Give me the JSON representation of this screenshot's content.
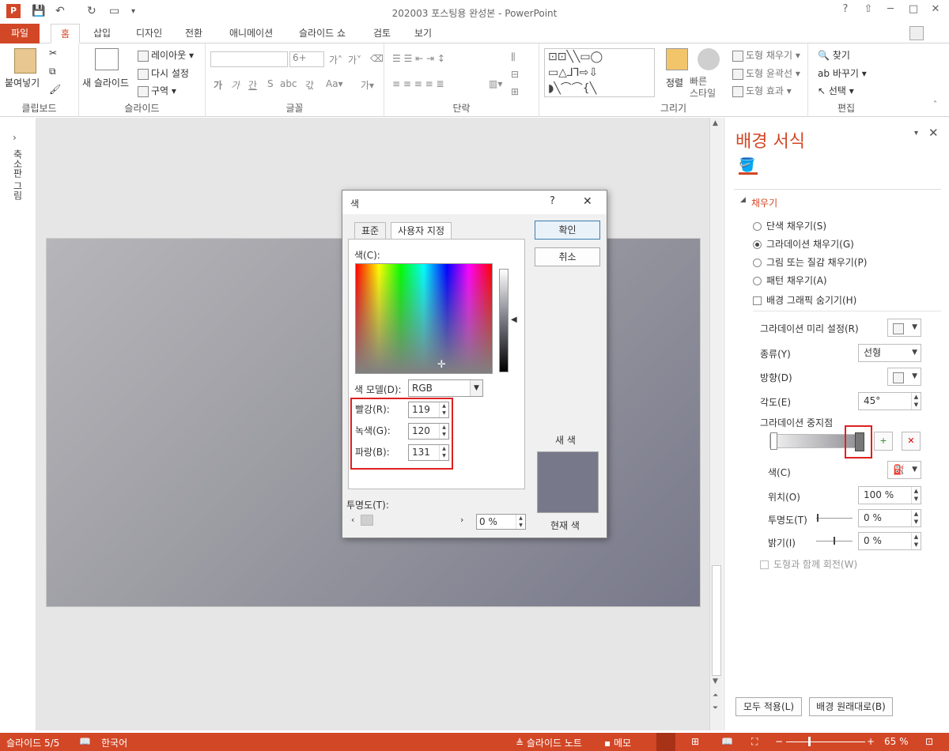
{
  "window": {
    "title": "202003 포스팅용 완성본 - PowerPoint",
    "help": "?",
    "minimize": "─",
    "maximize": "□",
    "close": "✕"
  },
  "tabs": [
    "파일",
    "홈",
    "삽입",
    "디자인",
    "전환",
    "애니메이션",
    "슬라이드 쇼",
    "검토",
    "보기"
  ],
  "ribbon": {
    "clipboard": {
      "label": "클립보드",
      "paste": "붙여넣기"
    },
    "slides": {
      "label": "슬라이드",
      "new_slide": "새 슬라이드",
      "layout": "레이아웃",
      "reset": "다시 설정",
      "section": "구역"
    },
    "font": {
      "label": "글꼴",
      "size": "6+"
    },
    "paragraph": {
      "label": "단락"
    },
    "drawing": {
      "label": "그리기",
      "arrange": "정렬",
      "quick_styles": "빠른\n스타일",
      "shape_fill": "도형 채우기",
      "shape_outline": "도형 윤곽선",
      "shape_effects": "도형 효과"
    },
    "editing": {
      "label": "편집",
      "find": "찾기",
      "replace": "바꾸기",
      "select": "선택"
    }
  },
  "left_strip": {
    "label": "축소판 그림"
  },
  "pane": {
    "title": "배경 서식",
    "section": "채우기",
    "options": [
      {
        "label": "단색 채우기(S)",
        "selected": false
      },
      {
        "label": "그라데이션 채우기(G)",
        "selected": true
      },
      {
        "label": "그림 또는 질감 채우기(P)",
        "selected": false
      },
      {
        "label": "패턴 채우기(A)",
        "selected": false
      }
    ],
    "hide_graphics": "배경 그래픽 숨기기(H)",
    "preset_label": "그라데이션 미리 설정(R)",
    "type_label": "종류(Y)",
    "type_value": "선형",
    "direction_label": "방향(D)",
    "angle_label": "각도(E)",
    "angle_value": "45°",
    "stops_label": "그라데이션 중지점",
    "color_label": "색(C)",
    "position_label": "위치(O)",
    "position_value": "100 %",
    "transparency_label": "투명도(T)",
    "transparency_value": "0 %",
    "brightness_label": "밝기(I)",
    "brightness_value": "0 %",
    "rotate_label": "도형과 함께 회전(W)",
    "apply_all": "모두 적용(L)",
    "reset_bg": "배경 원래대로(B)"
  },
  "dialog": {
    "title": "색",
    "help": "?",
    "close": "✕",
    "tab_standard": "표준",
    "tab_custom": "사용자 지정",
    "colors_label": "색(C):",
    "model_label": "색 모델(D):",
    "model_value": "RGB",
    "red_label": "빨강(R):",
    "red_value": "119",
    "green_label": "녹색(G):",
    "green_value": "120",
    "blue_label": "파랑(B):",
    "blue_value": "131",
    "transparency_label": "투명도(T):",
    "transparency_value": "0 %",
    "ok": "확인",
    "cancel": "취소",
    "new_label": "새 색",
    "current_label": "현재 색",
    "preview_color": "#77788a"
  },
  "status": {
    "slide": "슬라이드 5/5",
    "language": "한국어",
    "notes": "슬라이드 노트",
    "comments": "메모",
    "zoom": "65 %"
  },
  "colors": {
    "accent": "#d24726",
    "highlight": "#e02020"
  }
}
